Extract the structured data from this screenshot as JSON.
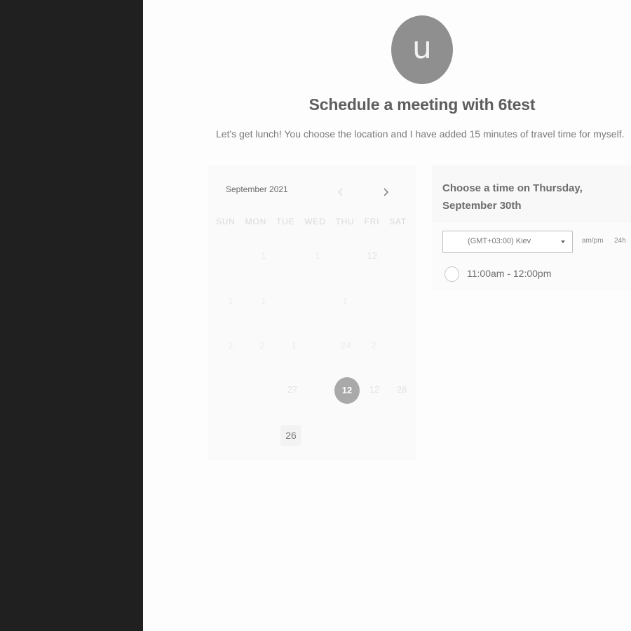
{
  "host": {
    "avatar_initial": "u",
    "title": "Schedule a meeting with 6test",
    "description": "Let's get lunch! You choose the location and I have added 15 minutes of travel time for myself."
  },
  "calendar": {
    "month": "September 2021",
    "weekdays": [
      "SUN",
      "MON",
      "TUE",
      "WED",
      "THU",
      "FRI",
      "SAT"
    ],
    "days": [
      {
        "label": "1",
        "style": "faint"
      },
      {
        "label": "1",
        "style": "faint"
      },
      {
        "label": "12",
        "style": "light"
      },
      {
        "label": "1",
        "style": "faint"
      },
      {
        "label": "1",
        "style": "faint"
      },
      {
        "label": "1",
        "style": "faint"
      },
      {
        "label": "2",
        "style": "faint"
      },
      {
        "label": "2",
        "style": "faint"
      },
      {
        "label": "1",
        "style": "faint"
      },
      {
        "label": "24",
        "style": "faint"
      },
      {
        "label": "2",
        "style": "faint"
      },
      {
        "label": "27",
        "style": "light"
      },
      {
        "label": "12",
        "style": "selected"
      },
      {
        "label": "12",
        "style": "light"
      },
      {
        "label": "28",
        "style": "light"
      },
      {
        "label": "26",
        "style": "available"
      }
    ],
    "selected_day": "12"
  },
  "times": {
    "heading": "Choose a time on Thursday, September 30th",
    "timezone": "(GMT+03:00) Kiev",
    "format_ampm": "am/pm",
    "format_24h": "24h",
    "slots": [
      {
        "label": "11:00am - 12:00pm"
      }
    ]
  },
  "colors": {
    "sidebar": "#202020",
    "selected_day": "#a9a9a9",
    "avatar": "#8f8f8f"
  }
}
